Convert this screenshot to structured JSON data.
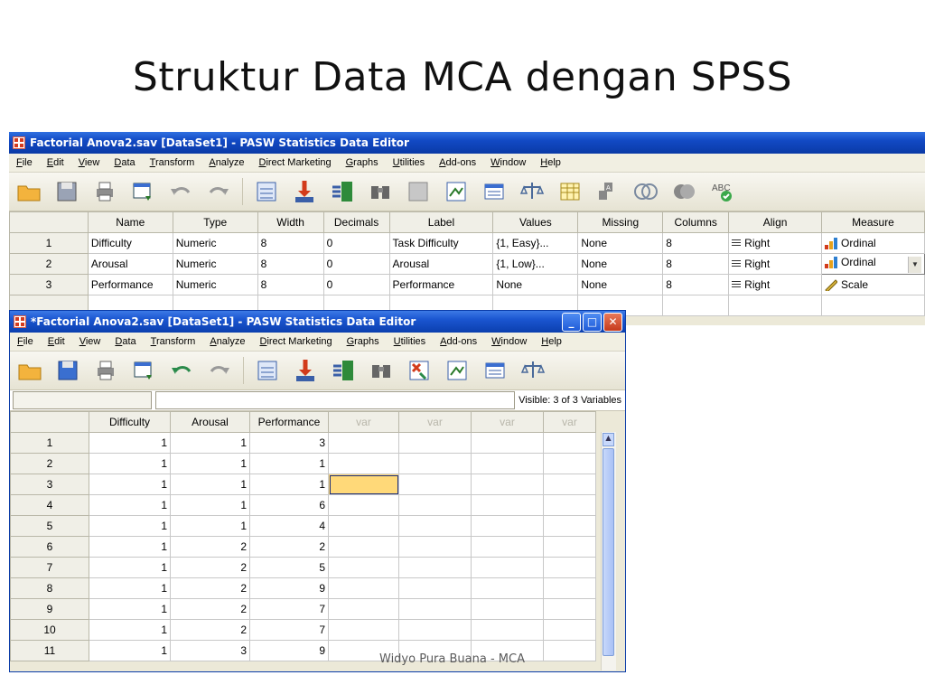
{
  "slide": {
    "title": "Struktur Data MCA dengan SPSS",
    "footer": "Widyo Pura Buana - MCA"
  },
  "variable_view": {
    "title": "Factorial Anova2.sav [DataSet1] - PASW Statistics Data Editor",
    "menu": [
      "File",
      "Edit",
      "View",
      "Data",
      "Transform",
      "Analyze",
      "Direct Marketing",
      "Graphs",
      "Utilities",
      "Add-ons",
      "Window",
      "Help"
    ],
    "columns": [
      "",
      "Name",
      "Type",
      "Width",
      "Decimals",
      "Label",
      "Values",
      "Missing",
      "Columns",
      "Align",
      "Measure"
    ],
    "rows": [
      {
        "id": "1",
        "name": "Difficulty",
        "type": "Numeric",
        "width": "8",
        "decimals": "0",
        "label": "Task Difficulty",
        "values": "{1, Easy}...",
        "missing": "None",
        "columns": "8",
        "align": "Right",
        "measure": "Ordinal"
      },
      {
        "id": "2",
        "name": "Arousal",
        "type": "Numeric",
        "width": "8",
        "decimals": "0",
        "label": "Arousal",
        "values": "{1, Low}...",
        "missing": "None",
        "columns": "8",
        "align": "Right",
        "measure": "Ordinal"
      },
      {
        "id": "3",
        "name": "Performance",
        "type": "Numeric",
        "width": "8",
        "decimals": "0",
        "label": "Performance",
        "values": "None",
        "missing": "None",
        "columns": "8",
        "align": "Right",
        "measure": "Scale"
      }
    ]
  },
  "data_view": {
    "title": "*Factorial Anova2.sav [DataSet1] - PASW Statistics Data Editor",
    "menu": [
      "File",
      "Edit",
      "View",
      "Data",
      "Transform",
      "Analyze",
      "Direct Marketing",
      "Graphs",
      "Utilities",
      "Add-ons",
      "Window",
      "Help"
    ],
    "visible_label": "Visible: 3 of 3 Variables",
    "columns": [
      "",
      "Difficulty",
      "Arousal",
      "Performance",
      "var",
      "var",
      "var",
      "var"
    ],
    "rows": [
      [
        "1",
        "1",
        "1",
        "3"
      ],
      [
        "2",
        "1",
        "1",
        "1"
      ],
      [
        "3",
        "1",
        "1",
        "1"
      ],
      [
        "4",
        "1",
        "1",
        "6"
      ],
      [
        "5",
        "1",
        "1",
        "4"
      ],
      [
        "6",
        "1",
        "2",
        "2"
      ],
      [
        "7",
        "1",
        "2",
        "5"
      ],
      [
        "8",
        "1",
        "2",
        "9"
      ],
      [
        "9",
        "1",
        "2",
        "7"
      ],
      [
        "10",
        "1",
        "2",
        "7"
      ],
      [
        "11",
        "1",
        "3",
        "9"
      ]
    ]
  },
  "colors": {
    "titlebar": "#1249c4",
    "selected_cell": "#ffd979",
    "chrome": "#ece9d8"
  }
}
